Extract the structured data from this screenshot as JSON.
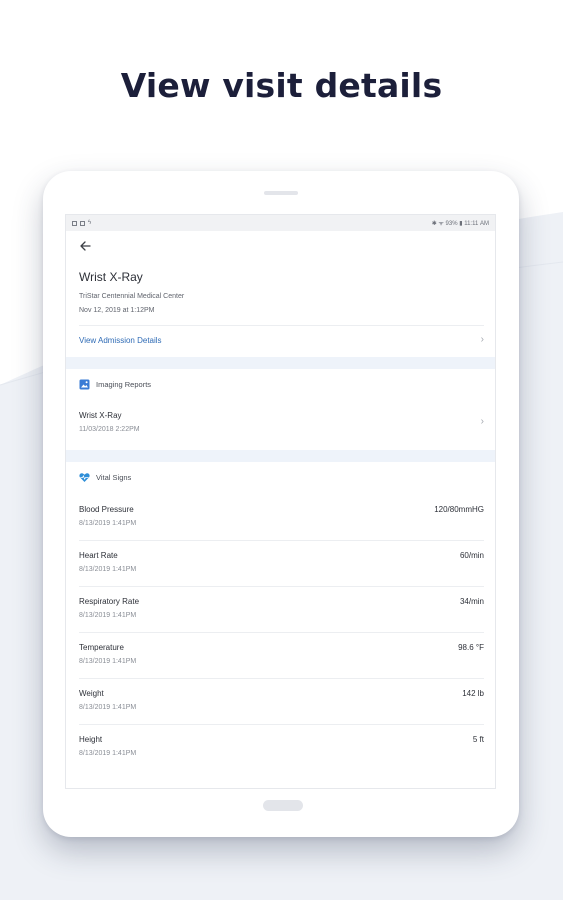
{
  "headline": "View visit details",
  "status_bar": {
    "right": "✱ ᯤ 93% ▮ 11:11 AM"
  },
  "visit": {
    "title": "Wrist X-Ray",
    "facility": "TriStar Centennial Medical Center",
    "date": "Nov 12, 2019 at 1:12PM",
    "admission_link": "View Admission Details"
  },
  "imaging": {
    "header": "Imaging Reports",
    "items": [
      {
        "label": "Wrist X-Ray",
        "date": "11/03/2018 2:22PM"
      }
    ]
  },
  "vitals": {
    "header": "Vital Signs",
    "items": [
      {
        "label": "Blood Pressure",
        "date": "8/13/2019 1:41PM",
        "value": "120/80mmHG"
      },
      {
        "label": "Heart Rate",
        "date": "8/13/2019 1:41PM",
        "value": "60/min"
      },
      {
        "label": "Respiratory Rate",
        "date": "8/13/2019 1:41PM",
        "value": "34/min"
      },
      {
        "label": "Temperature",
        "date": "8/13/2019 1:41PM",
        "value": "98.6 °F"
      },
      {
        "label": "Weight",
        "date": "8/13/2019 1:41PM",
        "value": "142 lb"
      },
      {
        "label": "Height",
        "date": "8/13/2019 1:41PM",
        "value": "5 ft"
      }
    ]
  },
  "colors": {
    "headline": "#1c1f3a",
    "link": "#2f6bb5",
    "section_band": "#eef3fa",
    "imaging_icon": "#3a7bd5",
    "vitals_icon": "#2f8fd8"
  }
}
